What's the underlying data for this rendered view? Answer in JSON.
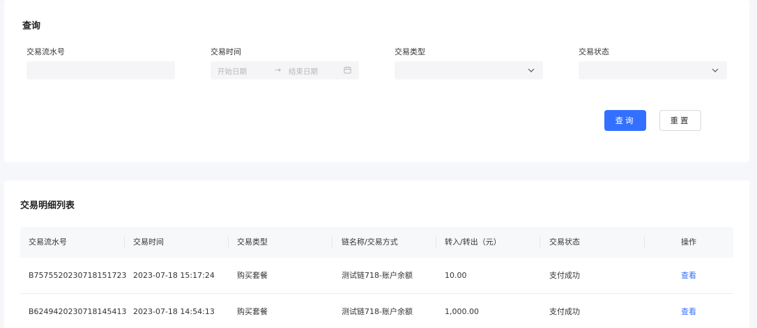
{
  "query": {
    "title": "查询",
    "fields": {
      "serial_no": {
        "label": "交易流水号",
        "value": ""
      },
      "time": {
        "label": "交易时间",
        "start_placeholder": "开始日期",
        "end_placeholder": "结束日期",
        "arrow": "→"
      },
      "type": {
        "label": "交易类型",
        "value": ""
      },
      "status": {
        "label": "交易状态",
        "value": ""
      }
    },
    "search_label": "查询",
    "reset_label": "重置",
    "colors": {
      "primary": "#3370ff"
    }
  },
  "list": {
    "title": "交易明细列表",
    "columns": [
      "交易流水号",
      "交易时间",
      "交易类型",
      "链名称/交易方式",
      "转入/转出（元）",
      "交易状态",
      "操作"
    ],
    "rows": [
      {
        "serial": "B7575520230718151723",
        "time": "2023-07-18 15:17:24",
        "type": "购买套餐",
        "chain": "测试链718-账户余额",
        "amount": "10.00",
        "status": "支付成功",
        "action": "查看"
      },
      {
        "serial": "B6249420230718145413",
        "time": "2023-07-18 14:54:13",
        "type": "购买套餐",
        "chain": "测试链718-账户余额",
        "amount": "1,000.00",
        "status": "支付成功",
        "action": "查看"
      }
    ]
  }
}
